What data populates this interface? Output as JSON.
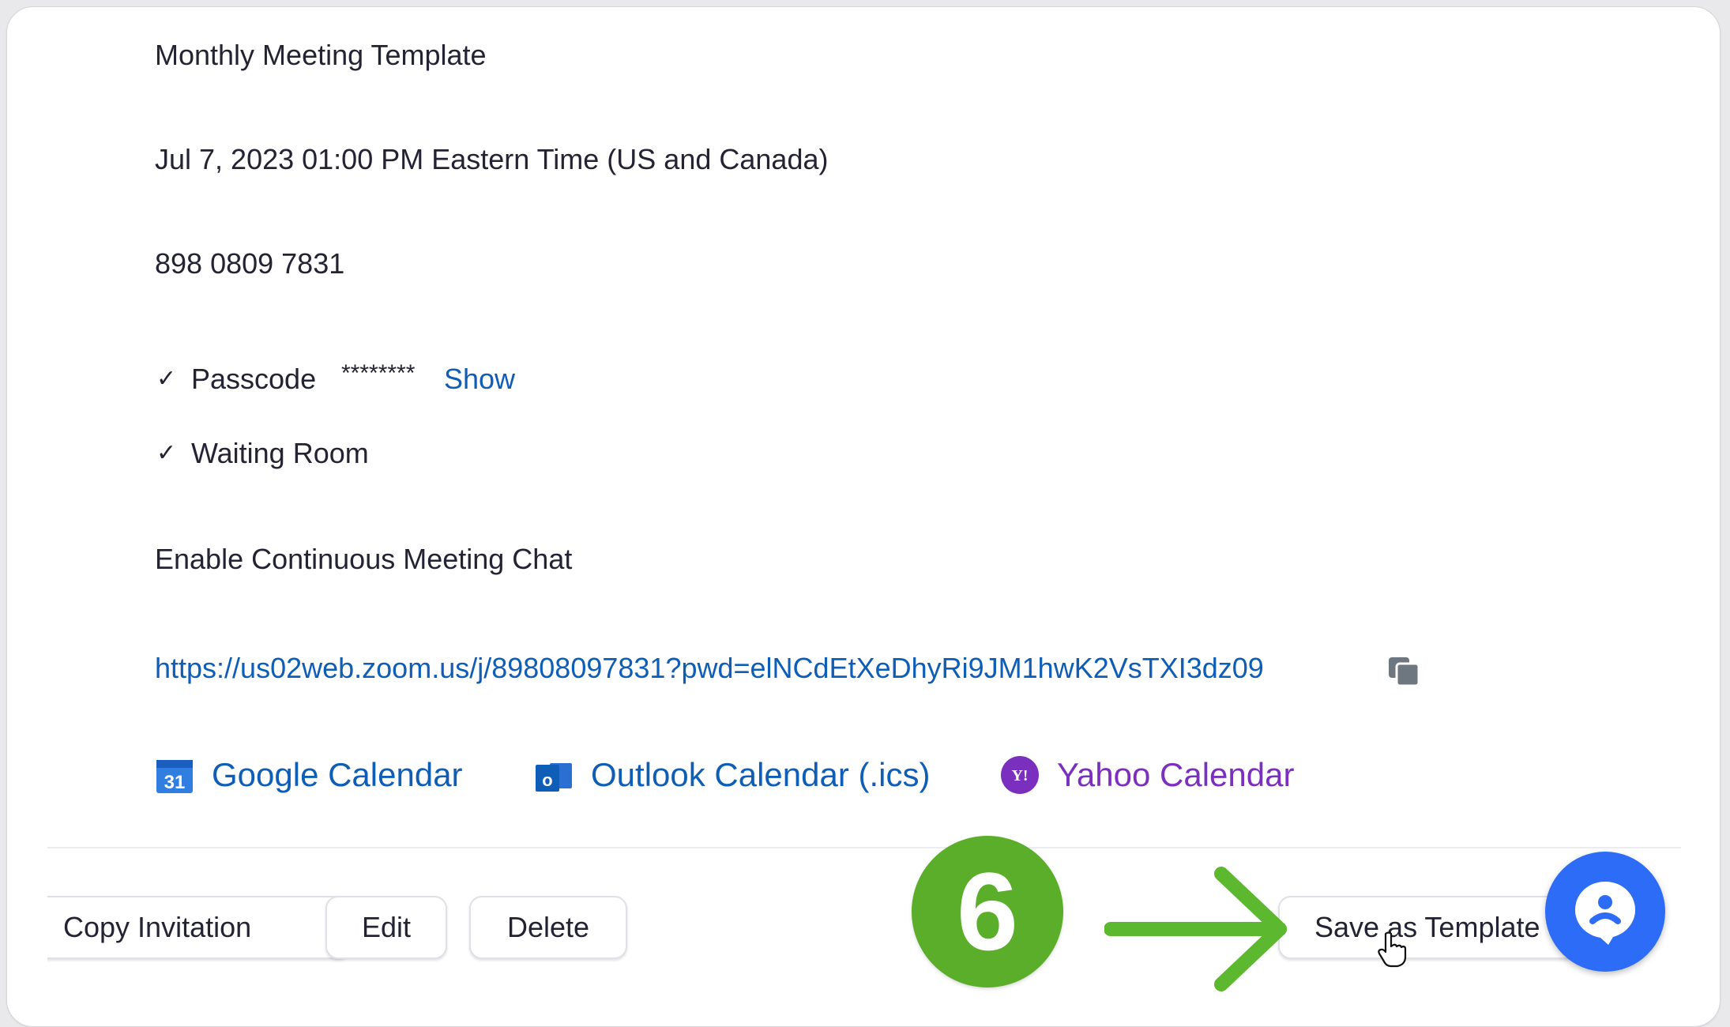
{
  "meeting": {
    "topic": "Monthly Meeting Template",
    "time": "Jul  7, 2023 01:00 PM Eastern Time (US and Canada)",
    "meeting_id": "898 0809 7831",
    "passcode_label": "Passcode",
    "passcode_value": "********",
    "show_label": "Show",
    "waiting_room_label": "Waiting Room",
    "continuous_chat_label": "Enable Continuous Meeting Chat",
    "invite_link": "https://us02web.zoom.us/j/89808097831?pwd=elNCdEtXeDhyRi9JM1hwK2VsTXI3dz09"
  },
  "calendars": {
    "google": "Google Calendar",
    "outlook": "Outlook Calendar (.ics)",
    "yahoo": "Yahoo Calendar"
  },
  "actions": {
    "copy_invitation": "Copy Invitation",
    "edit": "Edit",
    "delete": "Delete",
    "save_as_template": "Save as Template"
  },
  "annotation": {
    "step_number": "6"
  },
  "colors": {
    "link": "#0e5db7",
    "yahoo": "#7b2fbf",
    "step_badge": "#5aae2a",
    "chat_button": "#2d6cf6"
  },
  "icons": [
    "checkmark-icon",
    "copy-icon",
    "google-calendar-icon",
    "outlook-icon",
    "yahoo-icon",
    "chat-bot-icon",
    "arrow-right-icon",
    "hand-cursor-icon"
  ]
}
